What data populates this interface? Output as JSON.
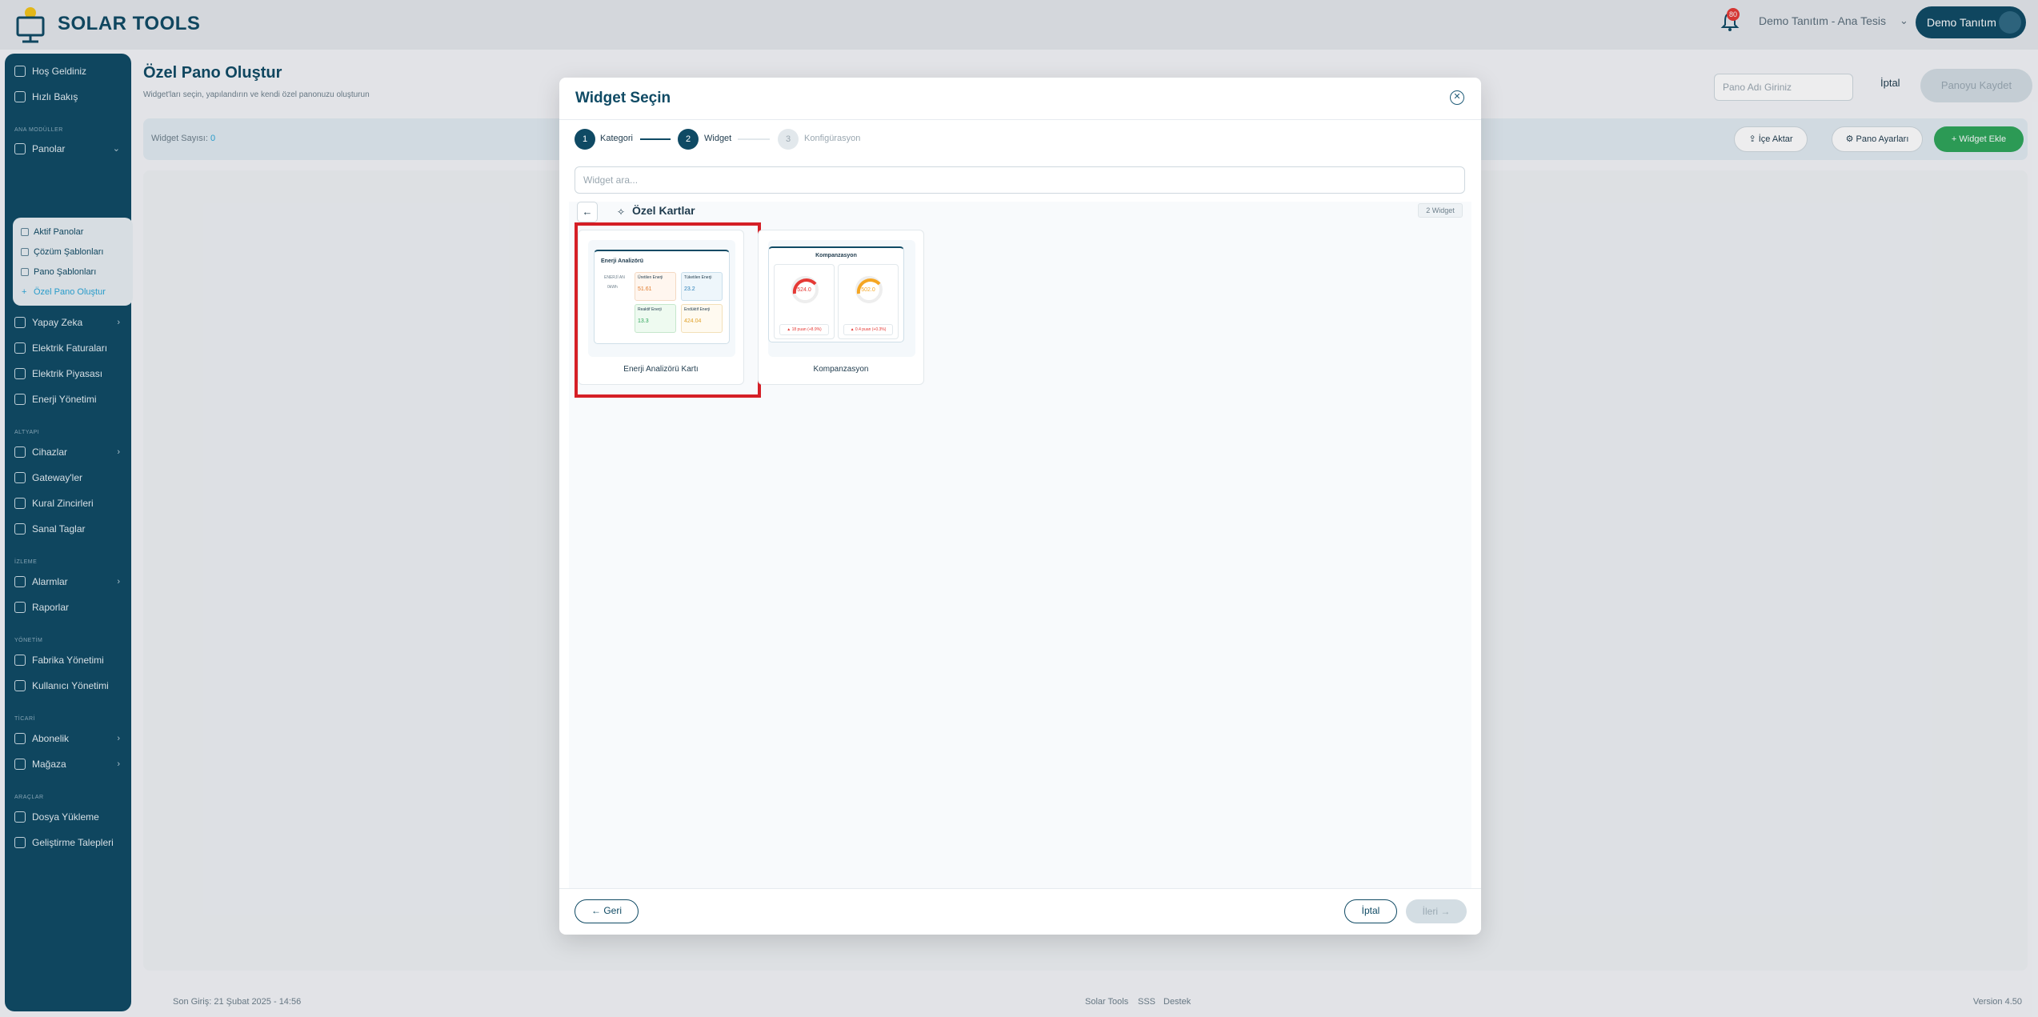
{
  "app": {
    "name": "SOLAR TOOLS",
    "notification_count": "80"
  },
  "header": {
    "tenant": "Demo Tanıtım - Ana Tesis",
    "user": "Demo Tanıtım"
  },
  "sidebar": {
    "items": [
      {
        "label": "Hoş Geldiniz"
      },
      {
        "label": "Hızlı Bakış"
      },
      {
        "label": "Panolar"
      },
      {
        "label": "Yapay Zeka"
      },
      {
        "label": "Elektrik Faturaları"
      },
      {
        "label": "Elektrik Piyasası"
      },
      {
        "label": "Enerji Yönetimi"
      },
      {
        "label": "Cihazlar"
      },
      {
        "label": "Gateway'ler"
      },
      {
        "label": "Kural Zincirleri"
      },
      {
        "label": "Sanal Taglar"
      },
      {
        "label": "Alarmlar"
      },
      {
        "label": "Raporlar"
      },
      {
        "label": "Fabrika Yönetimi"
      },
      {
        "label": "Kullanıcı Yönetimi"
      },
      {
        "label": "Abonelik"
      },
      {
        "label": "Mağaza"
      },
      {
        "label": "Dosya Yükleme"
      },
      {
        "label": "Geliştirme Talepleri"
      }
    ],
    "sections": [
      "ANA MODÜLLER",
      "ALTYAPI",
      "İZLEME",
      "YÖNETİM",
      "TİCARİ",
      "ARAÇLAR"
    ],
    "submenu": [
      {
        "label": "Aktif Panolar"
      },
      {
        "label": "Çözüm Şablonları"
      },
      {
        "label": "Pano Şablonları"
      },
      {
        "label": "Özel Pano Oluştur"
      }
    ]
  },
  "page": {
    "title": "Özel Pano Oluştur",
    "subtitle": "Widget'ları seçin, yapılandırın ve kendi özel panonuzu oluşturun",
    "name_placeholder": "Pano Adı Giriniz",
    "cancel": "İptal",
    "save": "Panoyu Kaydet",
    "widget_count_label": "Widget Sayısı:",
    "widget_count": "0",
    "import": "İçe Aktar",
    "settings": "Pano Ayarları",
    "add_widget": "Widget Ekle"
  },
  "modal": {
    "title": "Widget Seçin",
    "steps": [
      {
        "num": "1",
        "label": "Kategori"
      },
      {
        "num": "2",
        "label": "Widget"
      },
      {
        "num": "3",
        "label": "Konfigürasyon"
      }
    ],
    "search_placeholder": "Widget ara...",
    "category": "Özel Kartlar",
    "widget_count": "2 Widget",
    "widgets": [
      {
        "label": "Enerji Analizörü Kartı",
        "preview": {
          "title": "Enerji Analizörü",
          "left_top": "ENERJİ AN",
          "left_bottom": "0kWh",
          "cells": [
            {
              "label": "Üretilen Enerji",
              "value": "51.61"
            },
            {
              "label": "Tüketilen Enerji",
              "value": "23.2"
            },
            {
              "label": "Reaktif Enerji",
              "value": "13.3"
            },
            {
              "label": "Endüktif Enerji",
              "value": "424.04"
            }
          ]
        }
      },
      {
        "label": "Kompanzasyon",
        "preview": {
          "title": "Kompanzasyon",
          "gauge1": "524.0",
          "gauge2": "502.0",
          "stat1": "▲ 18 puan (+8.9%)",
          "stat2": "▲ 0.4 puan (+0.3%)"
        }
      }
    ],
    "back": "← Geri",
    "cancel": "İptal",
    "next": "İleri →"
  },
  "footer": {
    "last_login": "Son Giriş: 21 Şubat 2025 - 14:56",
    "links": [
      "Solar Tools",
      "SSS",
      "Destek"
    ],
    "version": "Version 4.50"
  }
}
